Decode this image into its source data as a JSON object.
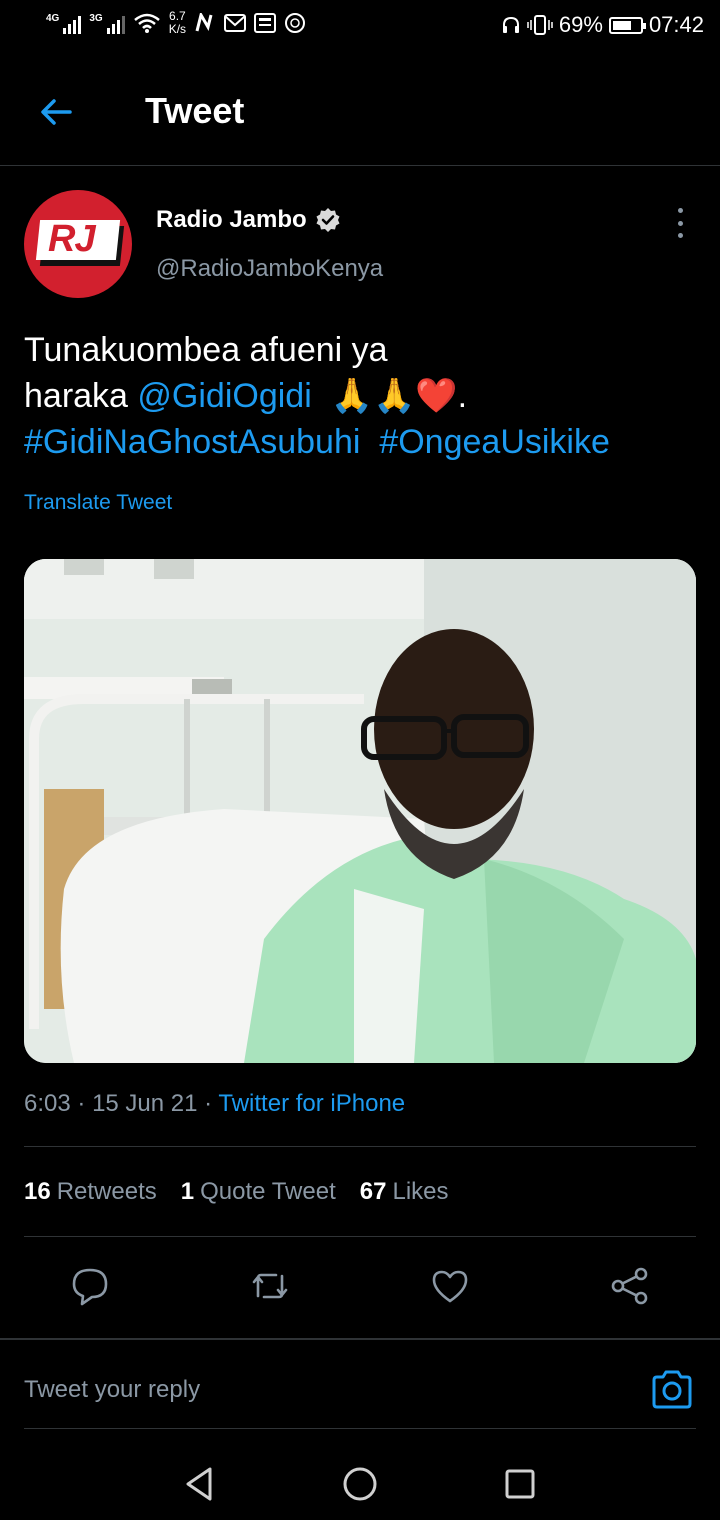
{
  "status_bar": {
    "net1": "4G",
    "net2": "3G",
    "speed_value": "6.7",
    "speed_unit": "K/s",
    "battery": "69%",
    "battery_level": 0.69,
    "time": "07:42"
  },
  "header": {
    "title": "Tweet"
  },
  "tweet": {
    "avatar_text": "RJ",
    "author": "Radio Jambo",
    "handle": "@RadioJamboKenya",
    "text_line1": "Tunakuombea afueni ya",
    "text_line2_prefix": "haraka ",
    "mention": "@GidiOgidi",
    "emojis": "🙏🙏❤️.",
    "hashtag1": "#GidiNaGhostAsubuhi",
    "hashtag2": "#OngeaUsikike",
    "translate": "Translate Tweet",
    "time": "6:03",
    "date": "15 Jun 21",
    "dot": "·",
    "source": "Twitter for iPhone"
  },
  "stats": {
    "retweets_count": "16",
    "retweets_label": "Retweets",
    "quotes_count": "1",
    "quotes_label": "Quote Tweet",
    "likes_count": "67",
    "likes_label": "Likes"
  },
  "reply": {
    "placeholder": "Tweet your reply"
  },
  "colors": {
    "accent": "#1d9bf0",
    "brand_red": "#d2202e",
    "muted": "#8b98a5",
    "divider": "#2f3336"
  }
}
